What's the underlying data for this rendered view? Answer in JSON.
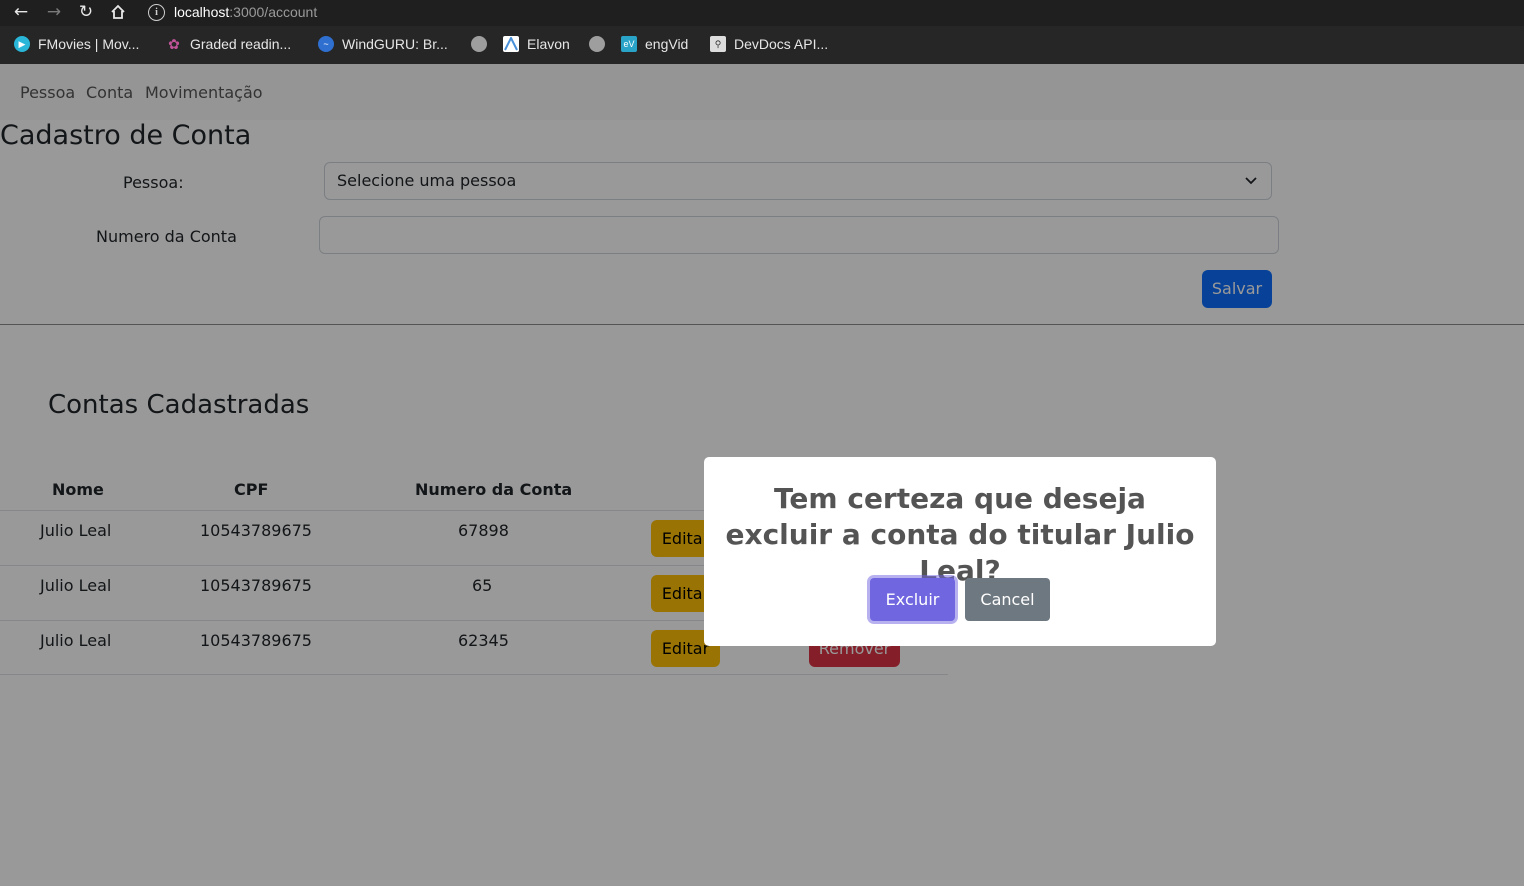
{
  "browser": {
    "url_host": "localhost",
    "url_path": ":3000/account",
    "bookmarks": [
      {
        "label": "FMovies | Mov...",
        "icon": "play-icon",
        "color": "#29b6d8"
      },
      {
        "label": "Graded readin...",
        "icon": "flower-icon",
        "color": "#c2549a"
      },
      {
        "label": "WindGURU: Br...",
        "icon": "wave-icon",
        "color": "#2f6fd0"
      },
      {
        "label": "",
        "icon": "globe-icon",
        "color": "#9e9e9e"
      },
      {
        "label": "Elavon",
        "icon": "elavon-icon",
        "color": "#4a90d9"
      },
      {
        "label": "",
        "icon": "globe-icon",
        "color": "#9e9e9e"
      },
      {
        "label": "engVid",
        "icon": "engvid-icon",
        "color": "#2aa3c8"
      },
      {
        "label": "DevDocs API...",
        "icon": "devdocs-icon",
        "color": "#dddddd"
      }
    ]
  },
  "navbar": {
    "items": [
      "Pessoa",
      "Conta",
      "Movimentação"
    ]
  },
  "form": {
    "title": "Cadastro de Conta",
    "pessoa_label": "Pessoa:",
    "pessoa_value": "Selecione uma pessoa",
    "conta_label": "Numero da Conta",
    "conta_value": "",
    "save_label": "Salvar"
  },
  "list": {
    "title": "Contas Cadastradas",
    "headers": [
      "Nome",
      "CPF",
      "Numero da Conta"
    ],
    "rows": [
      {
        "nome": "Julio Leal",
        "cpf": "10543789675",
        "conta": "67898"
      },
      {
        "nome": "Julio Leal",
        "cpf": "10543789675",
        "conta": "65"
      },
      {
        "nome": "Julio Leal",
        "cpf": "10543789675",
        "conta": "62345"
      }
    ],
    "edit_label": "Editar",
    "remove_label": "Remover"
  },
  "modal": {
    "title": "Tem certeza que deseja excluir a conta do titular Julio Leal?",
    "confirm_label": "Excluir",
    "cancel_label": "Cancel"
  },
  "colors": {
    "primary": "#0d6efd",
    "warning": "#ffc107",
    "danger": "#dc3545",
    "confirm": "#7066e0",
    "cancel": "#6e7881"
  }
}
